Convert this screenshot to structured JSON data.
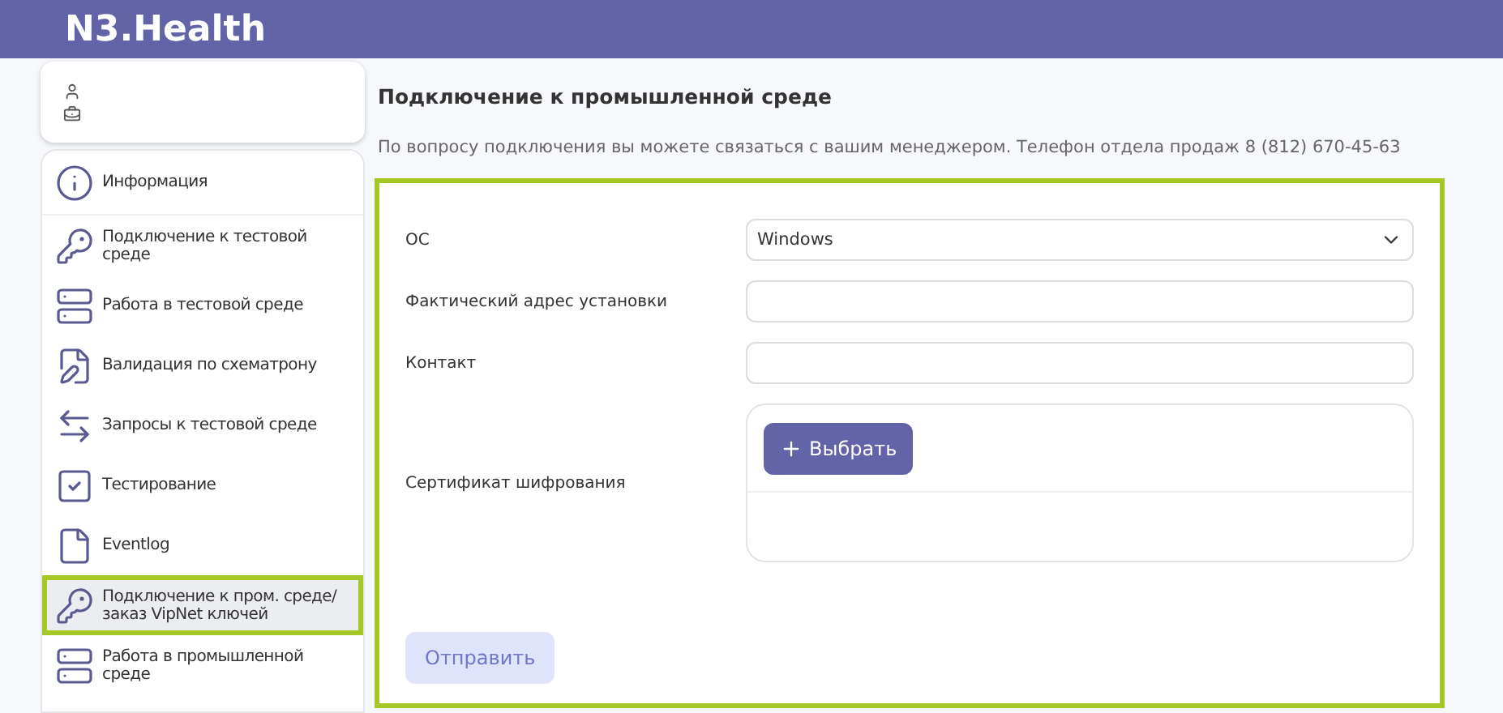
{
  "header": {
    "logo": "N3.Health"
  },
  "sidebar": {
    "items": [
      {
        "kind": "info",
        "label": "Информация",
        "selected": false
      },
      {
        "kind": "key",
        "label": "Подключение к тестовой среде",
        "selected": false
      },
      {
        "kind": "server",
        "label": "Работа в тестовой среде",
        "selected": false
      },
      {
        "kind": "file-edit",
        "label": "Валидация по схематрону",
        "selected": false
      },
      {
        "kind": "arrows",
        "label": "Запросы к тестовой среде",
        "selected": false
      },
      {
        "kind": "check",
        "label": "Тестирование",
        "selected": false
      },
      {
        "kind": "file",
        "label": "Eventlog",
        "selected": false
      },
      {
        "kind": "key",
        "label": "Подключение к пром. среде/ заказ VipNet ключей",
        "selected": true
      },
      {
        "kind": "server",
        "label": "Работа в промышленной среде",
        "selected": false
      }
    ]
  },
  "page": {
    "title": "Подключение к промышленной среде",
    "description": "По вопросу подключения вы можете связаться с вашим менеджером. Телефон отдела продаж 8 (812) 670-45-63"
  },
  "form": {
    "fields": [
      {
        "kind": "select",
        "label": "ОС",
        "value": "Windows"
      },
      {
        "kind": "input",
        "label": "Фактический адрес установки"
      },
      {
        "kind": "input",
        "label": "Контакт"
      },
      {
        "kind": "file",
        "label": "Сертификат шифрования",
        "button": "Выбрать"
      }
    ],
    "submit": {
      "label": "Отправить",
      "disabled": true
    }
  }
}
